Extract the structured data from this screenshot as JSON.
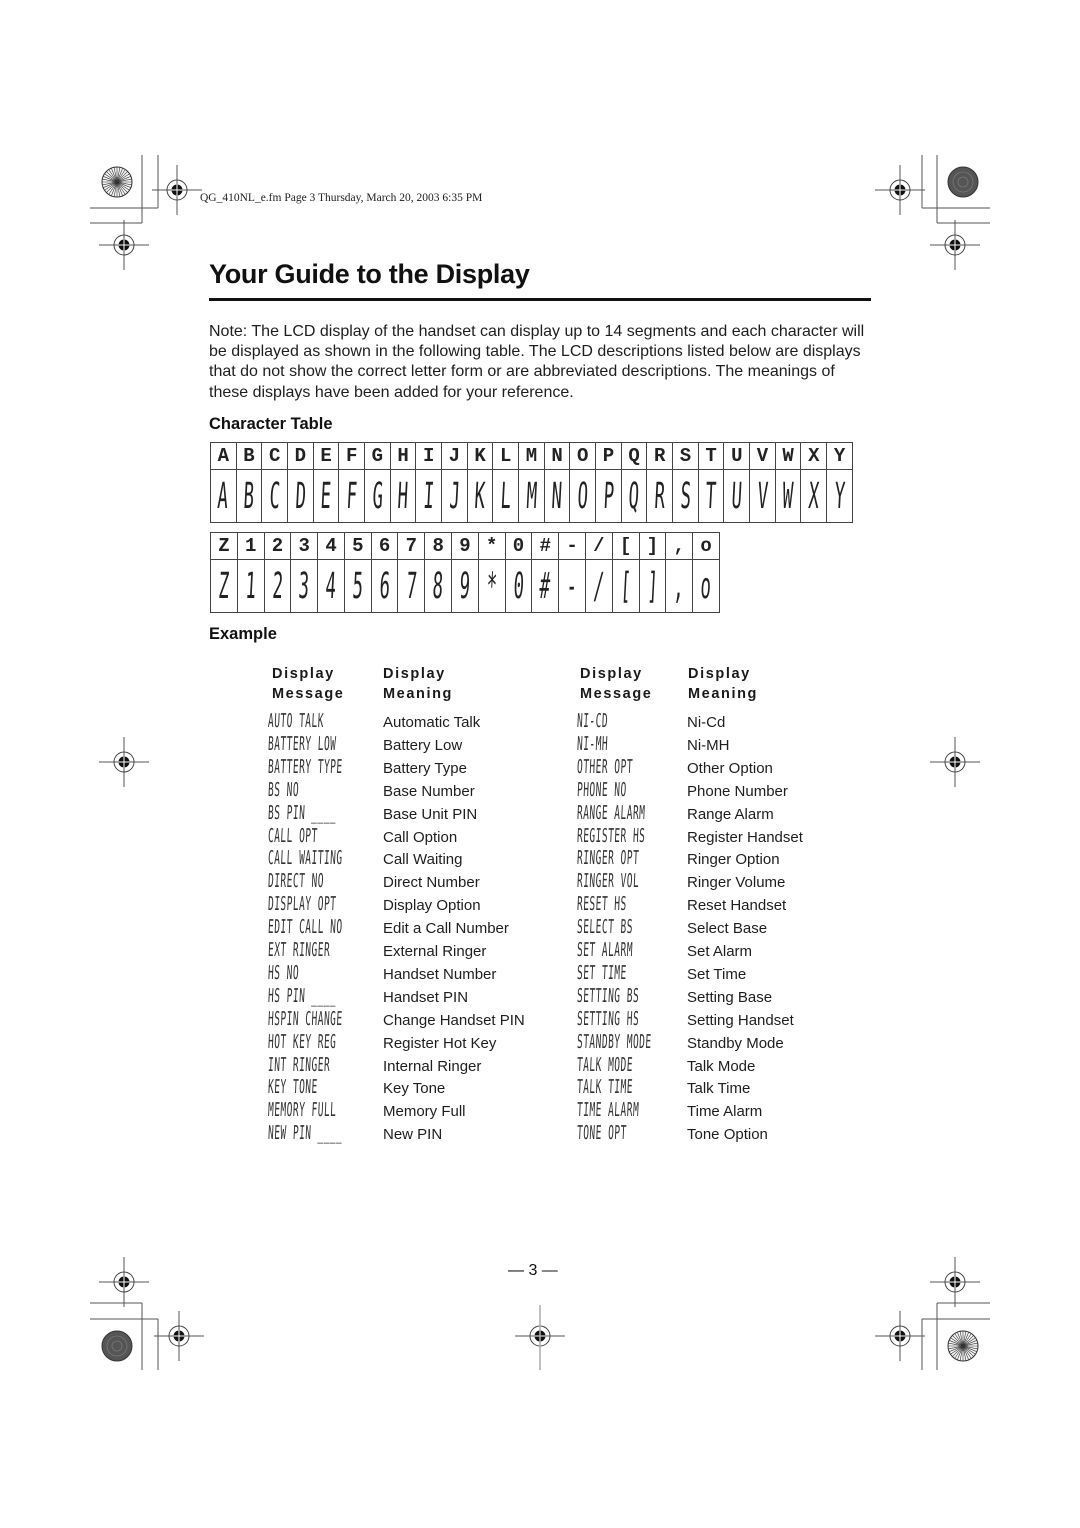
{
  "file_header": "QG_410NL_e.fm  Page 3  Thursday, March 20, 2003  6:35 PM",
  "title": "Your Guide to the Display",
  "note": "Note: The LCD display of the handset can display up to 14 segments and each character will be displayed as shown in the following table. The LCD descriptions listed below are displays that do not show the correct letter form or are abbreviated descriptions. The meanings of these displays have been added for your reference.",
  "character_table": {
    "heading": "Character Table",
    "row1": [
      "A",
      "B",
      "C",
      "D",
      "E",
      "F",
      "G",
      "H",
      "I",
      "J",
      "K",
      "L",
      "M",
      "N",
      "O",
      "P",
      "Q",
      "R",
      "S",
      "T",
      "U",
      "V",
      "W",
      "X",
      "Y"
    ],
    "row2": [
      "Z",
      "1",
      "2",
      "3",
      "4",
      "5",
      "6",
      "7",
      "8",
      "9",
      "*",
      "0",
      "#",
      "-",
      "/",
      "[",
      "]",
      ",",
      "o"
    ]
  },
  "example": {
    "heading": "Example",
    "columns": {
      "msg_line1": "Display",
      "msg_line2": "Message",
      "mean_line1": "Display",
      "mean_line2": "Meaning"
    },
    "left": [
      {
        "message": "AUTO TALK",
        "meaning": "Automatic Talk"
      },
      {
        "message": "BATTERY LOW",
        "meaning": "Battery Low"
      },
      {
        "message": "BATTERY TYPE",
        "meaning": "Battery Type"
      },
      {
        "message": "BS NO",
        "meaning": "Base Number"
      },
      {
        "message": "BS PIN ____",
        "meaning": "Base Unit PIN"
      },
      {
        "message": "CALL OPT",
        "meaning": "Call Option"
      },
      {
        "message": "CALL WAITING",
        "meaning": "Call Waiting"
      },
      {
        "message": "DIRECT NO",
        "meaning": "Direct Number"
      },
      {
        "message": "DISPLAY OPT",
        "meaning": "Display Option"
      },
      {
        "message": "EDIT CALL NO",
        "meaning": "Edit a Call Number"
      },
      {
        "message": "EXT RINGER",
        "meaning": "External Ringer"
      },
      {
        "message": "HS NO",
        "meaning": "Handset Number"
      },
      {
        "message": "HS PIN ____",
        "meaning": "Handset PIN"
      },
      {
        "message": "HSPIN CHANGE",
        "meaning": "Change Handset PIN"
      },
      {
        "message": "HOT KEY REG",
        "meaning": "Register Hot Key"
      },
      {
        "message": "INT RINGER",
        "meaning": "Internal Ringer"
      },
      {
        "message": "KEY TONE",
        "meaning": "Key Tone"
      },
      {
        "message": "MEMORY FULL",
        "meaning": "Memory Full"
      },
      {
        "message": "NEW PIN ____",
        "meaning": "New PIN"
      }
    ],
    "right": [
      {
        "message": "NI-CD",
        "meaning": "Ni-Cd"
      },
      {
        "message": "NI-MH",
        "meaning": "Ni-MH"
      },
      {
        "message": "OTHER OPT",
        "meaning": "Other Option"
      },
      {
        "message": "PHONE NO",
        "meaning": "Phone Number"
      },
      {
        "message": "RANGE ALARM",
        "meaning": "Range Alarm"
      },
      {
        "message": "REGISTER HS",
        "meaning": "Register Handset"
      },
      {
        "message": "RINGER OPT",
        "meaning": "Ringer Option"
      },
      {
        "message": "RINGER VOL",
        "meaning": "Ringer Volume"
      },
      {
        "message": "RESET HS",
        "meaning": "Reset Handset"
      },
      {
        "message": "SELECT BS",
        "meaning": "Select Base"
      },
      {
        "message": "SET ALARM",
        "meaning": "Set Alarm"
      },
      {
        "message": "SET TIME",
        "meaning": "Set Time"
      },
      {
        "message": "SETTING BS",
        "meaning": "Setting Base"
      },
      {
        "message": "SETTING HS",
        "meaning": "Setting Handset"
      },
      {
        "message": "STANDBY MODE",
        "meaning": "Standby Mode"
      },
      {
        "message": "TALK MODE",
        "meaning": "Talk Mode"
      },
      {
        "message": "TALK TIME",
        "meaning": "Talk Time"
      },
      {
        "message": "TIME ALARM",
        "meaning": "Time Alarm"
      },
      {
        "message": "TONE OPT",
        "meaning": "Tone Option"
      }
    ]
  },
  "page_number": "— 3 —",
  "print_marks": {
    "registration_icon": "crosshair-target-icon",
    "color_wheel_icon": "starburst-wheel-icon",
    "gray_disc_icon": "gray-disc-icon"
  }
}
